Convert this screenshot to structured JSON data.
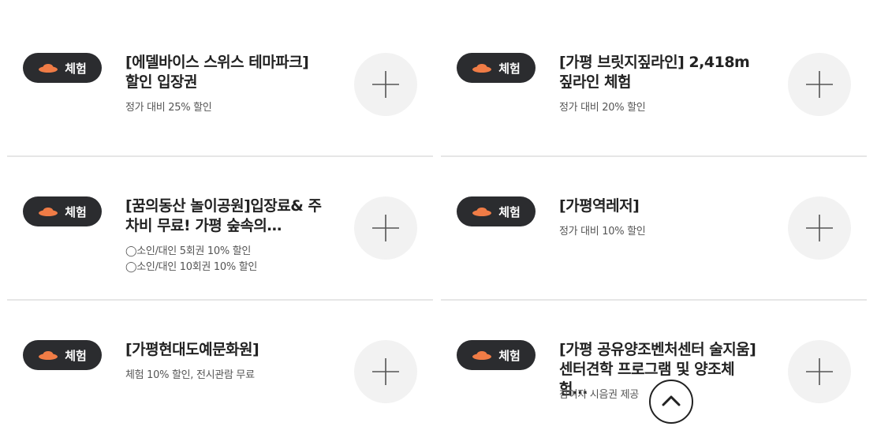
{
  "items": [
    {
      "badge": "체험",
      "title": "[에델바이스 스위스 테마파크] 할인 입장권",
      "desc": [
        "정가 대비 25% 할인"
      ]
    },
    {
      "badge": "체험",
      "title": "[가평 브릿지짚라인] 2,418m 짚라인 체험",
      "desc": [
        "정가 대비 20% 할인"
      ]
    },
    {
      "badge": "체험",
      "title": "[꿈의동산 놀이공원]입장료& 주차비 무료! 가평 숲속의…",
      "desc": [
        "◯소인/대인 5회권 10% 할인",
        "◯소인/대인 10회권 10% 할인"
      ]
    },
    {
      "badge": "체험",
      "title": "[가평역레저]",
      "desc": [
        "정가 대비 10% 할인"
      ]
    },
    {
      "badge": "체험",
      "title": "[가평현대도예문화원]",
      "desc": [
        "체험 10% 할인, 전시관람 무료"
      ]
    },
    {
      "badge": "체험",
      "title": "[가평 공유양조벤처센터 술지움] 센터견학 프로그램 및 양조체험…",
      "desc": [
        "참여자 시음권 제공"
      ]
    }
  ],
  "icons": {
    "badge": "hat-icon",
    "add": "plus-icon",
    "scroll": "chevron-up-icon"
  },
  "colors": {
    "badge_bg": "#2b2c2f",
    "hat": "#f07c46",
    "add_bg": "#f2f2f2"
  }
}
